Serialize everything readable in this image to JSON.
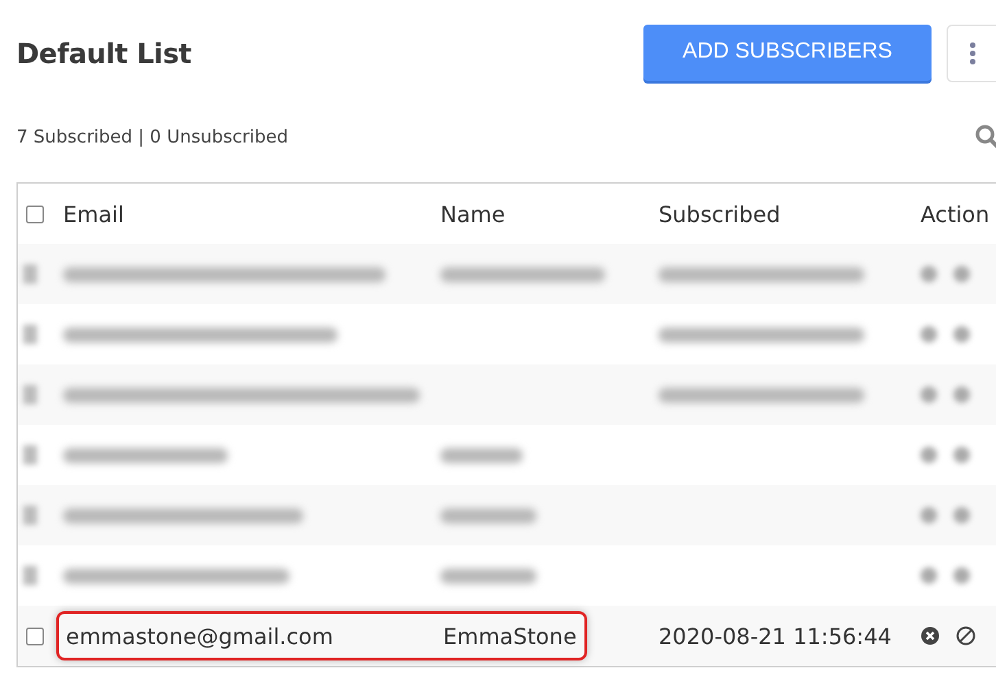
{
  "title": "Default List",
  "add_button": "ADD SUBSCRIBERS",
  "counts": "7 Subscribed | 0 Unsubscribed",
  "table": {
    "select_all_checked": false,
    "columns": [
      "Email",
      "Name",
      "Subscribed",
      "Action"
    ],
    "rows": [
      {
        "kind": "blurred",
        "checked": false,
        "email": true,
        "name": true,
        "subscribed": true
      },
      {
        "kind": "blurred",
        "checked": false,
        "email": true,
        "name": false,
        "subscribed": true
      },
      {
        "kind": "blurred",
        "checked": false,
        "email": true,
        "name": false,
        "subscribed": true
      },
      {
        "kind": "blurred",
        "checked": false,
        "email": true,
        "name": true,
        "subscribed": false
      },
      {
        "kind": "blurred",
        "checked": false,
        "email": true,
        "name": true,
        "subscribed": false
      },
      {
        "kind": "blurred",
        "checked": false,
        "email": true,
        "name": true,
        "subscribed": false
      },
      {
        "kind": "normal",
        "checked": false,
        "highlighted": true,
        "email": "emmastone@gmail.com",
        "name": "EmmaStone",
        "subscribed": "2020-08-21 11:56:44"
      }
    ]
  }
}
